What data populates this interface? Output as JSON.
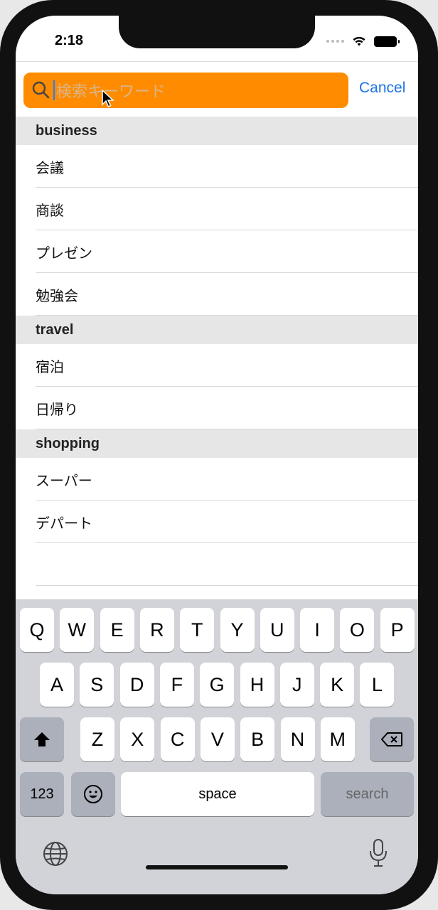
{
  "status": {
    "time": "2:18"
  },
  "search": {
    "placeholder": "検索キーワード",
    "cancel_label": "Cancel"
  },
  "sections": [
    {
      "title": "business",
      "items": [
        "会議",
        "商談",
        "プレゼン",
        "勉強会"
      ]
    },
    {
      "title": "travel",
      "items": [
        "宿泊",
        "日帰り"
      ]
    },
    {
      "title": "shopping",
      "items": [
        "スーパー",
        "デパート"
      ]
    }
  ],
  "keyboard": {
    "row1": [
      "Q",
      "W",
      "E",
      "R",
      "T",
      "Y",
      "U",
      "I",
      "O",
      "P"
    ],
    "row2": [
      "A",
      "S",
      "D",
      "F",
      "G",
      "H",
      "J",
      "K",
      "L"
    ],
    "row3": [
      "Z",
      "X",
      "C",
      "V",
      "B",
      "N",
      "M"
    ],
    "numbers_label": "123",
    "space_label": "space",
    "search_label": "search"
  },
  "colors": {
    "search_field": "#ff8c00",
    "accent": "#1a73e8",
    "section_bg": "#e6e6e6",
    "keyboard_bg": "#d1d3d9"
  },
  "icons": [
    "search-icon",
    "wifi-icon",
    "battery-icon",
    "shift-icon",
    "delete-icon",
    "emoji-icon",
    "globe-icon",
    "microphone-icon",
    "mouse-cursor-icon"
  ]
}
